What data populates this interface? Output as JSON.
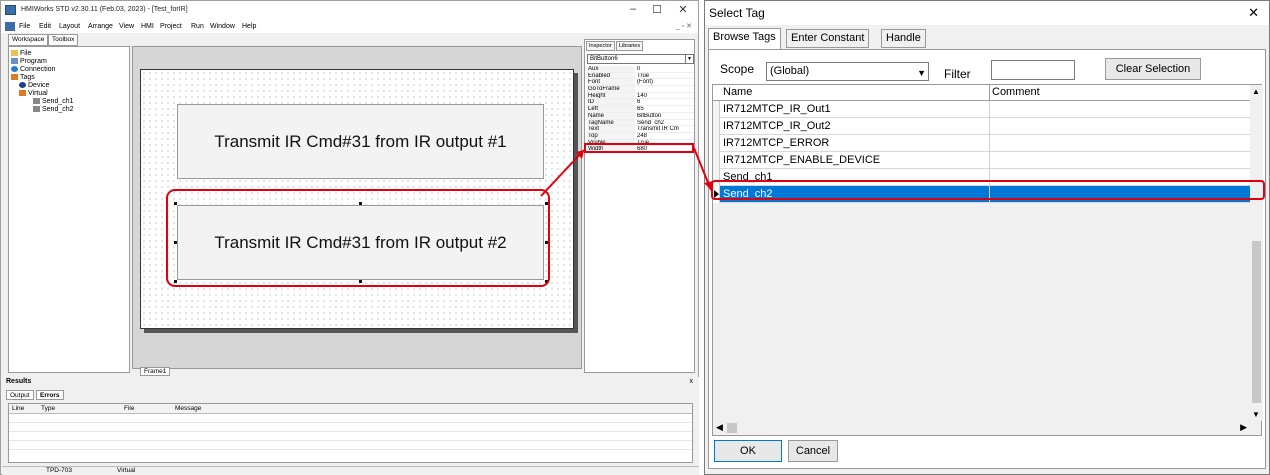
{
  "hmi": {
    "title": "HMIWorks STD v2.30.11 (Feb.03, 2023) - [Test_forIR]",
    "window_controls": [
      "–",
      "☐",
      "✕"
    ],
    "mdi_controls": "_ ▫ ✕",
    "menu": [
      "File",
      "Edit",
      "Layout",
      "Arrange",
      "View",
      "HMI",
      "Project",
      "Run",
      "Window",
      "Help"
    ],
    "left_tabs": [
      "Workspace",
      "Toolbox"
    ],
    "tree": [
      "File",
      "Program",
      "Connection",
      "Tags",
      "Device",
      "Virtual",
      "Send_ch1",
      "Send_ch2"
    ],
    "frame_tab": "Frame1",
    "buttons": [
      "Transmit IR Cmd#31 from IR output #1",
      "Transmit IR Cmd#31 from IR output #2"
    ],
    "inspector": {
      "tabs": [
        "Inspector",
        "Libraries"
      ],
      "selected_object": "BitButton6",
      "props": [
        {
          "k": "Aux",
          "v": "0"
        },
        {
          "k": "Enabled",
          "v": "True"
        },
        {
          "k": "Font",
          "v": "(Font)"
        },
        {
          "k": "GoToFrame",
          "v": ""
        },
        {
          "k": "Height",
          "v": "140"
        },
        {
          "k": "ID",
          "v": "6"
        },
        {
          "k": "Left",
          "v": "65"
        },
        {
          "k": "Name",
          "v": "BitButton"
        },
        {
          "k": "TagName",
          "v": "Send_ch2"
        },
        {
          "k": "Text",
          "v": "Transmit IR Cm"
        },
        {
          "k": "Top",
          "v": "248"
        },
        {
          "k": "Visible",
          "v": "True"
        },
        {
          "k": "Width",
          "v": "680"
        }
      ]
    },
    "results": {
      "title": "Results",
      "close": "x",
      "tabs": [
        "Output",
        "Errors"
      ],
      "columns": [
        "Line",
        "Type",
        "File",
        "Message"
      ]
    },
    "status": [
      "TPD-703",
      "Virtual"
    ]
  },
  "dialog": {
    "title": "Select Tag",
    "close": "✕",
    "tabs": [
      "Browse Tags",
      "Enter Constant",
      "Handle"
    ],
    "scope_label": "Scope",
    "scope_value": "(Global)",
    "filter_label": "Filter",
    "filter_value": "",
    "clear_button": "Clear Selection",
    "columns": [
      "Name",
      "Comment"
    ],
    "rows": [
      {
        "name": "IR712MTCP_IR_Out1",
        "comment": ""
      },
      {
        "name": "IR712MTCP_IR_Out2",
        "comment": ""
      },
      {
        "name": "IR712MTCP_ERROR",
        "comment": ""
      },
      {
        "name": "IR712MTCP_ENABLE_DEVICE",
        "comment": ""
      },
      {
        "name": "Send_ch1",
        "comment": ""
      },
      {
        "name": "Send_ch2",
        "comment": ""
      }
    ],
    "selected_row": "Send_ch2",
    "ok_button": "OK",
    "cancel_button": "Cancel"
  },
  "colors": {
    "annotation": "#e0000e",
    "selection": "#0078d7"
  }
}
